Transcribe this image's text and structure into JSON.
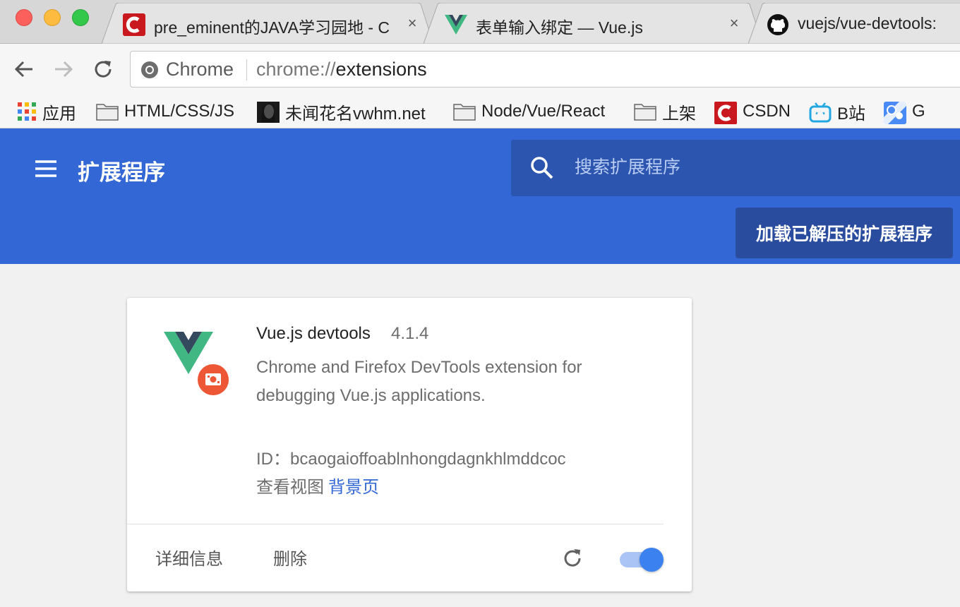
{
  "tabs": [
    {
      "title": "pre_eminent的JAVA学习园地 - C",
      "close": "×",
      "icon": "csdn-icon"
    },
    {
      "title": "表单输入绑定 — Vue.js",
      "close": "×",
      "icon": "vue-icon"
    },
    {
      "title": "vuejs/vue-devtools:",
      "icon": "github-icon"
    }
  ],
  "omnibox": {
    "chip": "Chrome",
    "scheme": "chrome://",
    "path": "extensions"
  },
  "bookmarks": [
    {
      "label": "应用",
      "icon": "apps-grid-icon"
    },
    {
      "label": "HTML/CSS/JS",
      "icon": "folder-icon"
    },
    {
      "label": "未闻花名vwhm.net",
      "icon": "portrait-icon"
    },
    {
      "label": "Node/Vue/React",
      "icon": "folder-icon"
    },
    {
      "label": "上架",
      "icon": "folder-icon"
    },
    {
      "label": "CSDN",
      "icon": "csdn-icon"
    },
    {
      "label": "B站",
      "icon": "bilibili-icon"
    },
    {
      "label": "G",
      "icon": "google-maps-icon"
    }
  ],
  "header": {
    "title": "扩展程序",
    "search_placeholder": "搜索扩展程序",
    "load_unpacked_label": "加载已解压的扩展程序"
  },
  "extension": {
    "name": "Vue.js devtools",
    "version": "4.1.4",
    "description": "Chrome and Firefox DevTools extension for debugging Vue.js applications.",
    "id_line": "ID：bcaogaioffoablnhongdagnkhlmddcoc",
    "views_label": "查看视图",
    "views_link": "背景页",
    "details_label": "详细信息",
    "remove_label": "删除",
    "enabled": true
  },
  "colors": {
    "header_bg": "#3367d6",
    "search_bg": "#2c55b0",
    "load_button_bg": "#2a4c9f",
    "toggle_knob": "#3b82f0",
    "link": "#3367d6"
  }
}
